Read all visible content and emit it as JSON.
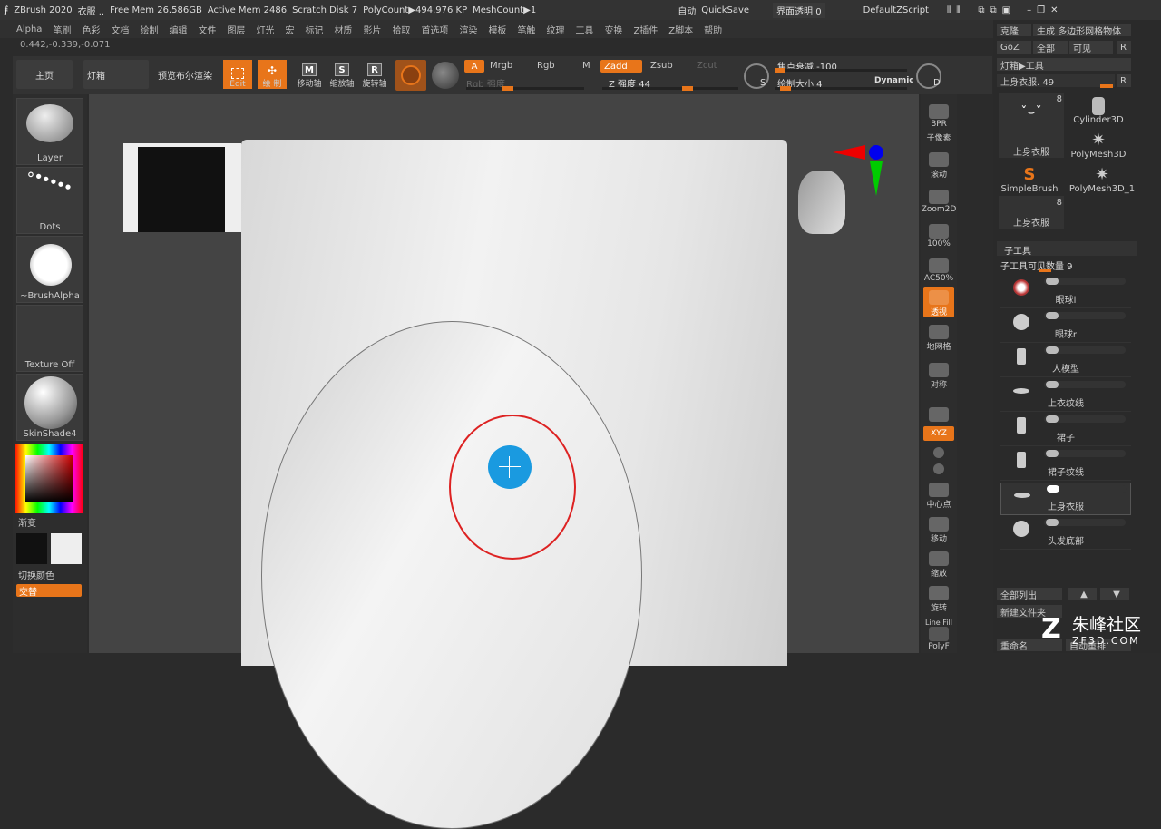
{
  "title_bar": {
    "app": "ZBrush 2020",
    "doc": "衣服 ..",
    "free_mem": "Free Mem 26.586GB",
    "active_mem": "Active Mem 2486",
    "scratch": "Scratch Disk 7",
    "poly_count": "PolyCount▶494.976 KP",
    "mesh_count": "MeshCount▶1",
    "auto": "自动",
    "quicksave": "QuickSave",
    "transparency": "界面透明 0",
    "script": "DefaultZScript"
  },
  "menu": [
    "Alpha",
    "笔刷",
    "色彩",
    "文档",
    "绘制",
    "编辑",
    "文件",
    "图层",
    "灯光",
    "宏",
    "标记",
    "材质",
    "影片",
    "拾取",
    "首选项",
    "渲染",
    "模板",
    "笔触",
    "纹理",
    "工具",
    "变换",
    "Z插件",
    "Z脚本",
    "帮助"
  ],
  "coords": "0.442,-0.339,-0.071",
  "toolbar": {
    "home": "主页",
    "lightbox": "灯箱",
    "bpr_preview": "预览布尔渲染",
    "edit": "Edit",
    "draw": "绘 制",
    "move": "移动轴",
    "scale": "缩放轴",
    "rotate": "旋转轴",
    "move_g": "M",
    "scale_g": "S",
    "rotate_g": "R",
    "a": "A",
    "mrgb": "Mrgb",
    "rgb": "Rgb",
    "m": "M",
    "zadd": "Zadd",
    "zsub": "Zsub",
    "zcut": "Zcut",
    "rgb_intensity": "Rgb 强度",
    "z_intensity": "Z 强度 44",
    "focal_shift": "焦点衰减 -100",
    "draw_size": "绘制大小 4",
    "dynamic": "Dynamic",
    "s": "S",
    "d": "D"
  },
  "left_tiles": [
    "Layer",
    "Dots",
    "~BrushAlpha",
    "Texture Off",
    "SkinShade4"
  ],
  "left_bottom": {
    "gradient": "渐变",
    "switch_color": "切换颜色",
    "alternate": "交替"
  },
  "right_icons": [
    "BPR",
    "子像素",
    "滚动",
    "Zoom2D",
    "100%",
    "AC50%",
    "透视",
    "地网格",
    "对称",
    "",
    "XYZ",
    "",
    "",
    "中心点",
    "移动",
    "缩放",
    "旋转",
    "Line Fill",
    "PolyF"
  ],
  "right_panel": {
    "clone": "克隆",
    "make_polymesh": "生成 多边形网格物体",
    "goz": "GoZ",
    "all": "全部",
    "visible": "可见",
    "r": "R",
    "lightbox_tool": "灯箱▶工具",
    "current_tool": "上身衣服. 49",
    "tools": [
      {
        "label": "上身衣服",
        "badge": "8"
      },
      {
        "label": "Cylinder3D",
        "badge": ""
      },
      {
        "label": "PolyMesh3D",
        "badge": ""
      },
      {
        "label": "SimpleBrush",
        "badge": ""
      },
      {
        "label": "PolyMesh3D_1",
        "badge": ""
      },
      {
        "label": "上身衣服",
        "badge": "8"
      }
    ],
    "subtool_header": "子工具",
    "subtool_count": "子工具可见数量 9",
    "subtools": [
      "眼球l",
      "眼球r",
      "人模型",
      "上衣纹线",
      "裙子",
      "裙子纹线",
      "上身衣服",
      "头发底部"
    ],
    "list_all": "全部列出",
    "new_folder": "新建文件夹",
    "rename": "重命名",
    "auto_rename": "自动重排"
  },
  "watermark": {
    "text": "朱峰社区",
    "url": "ZF3D.COM"
  },
  "colors": {
    "accent": "#e8751a",
    "bg": "#2b2b2b",
    "panel": "#333333"
  }
}
